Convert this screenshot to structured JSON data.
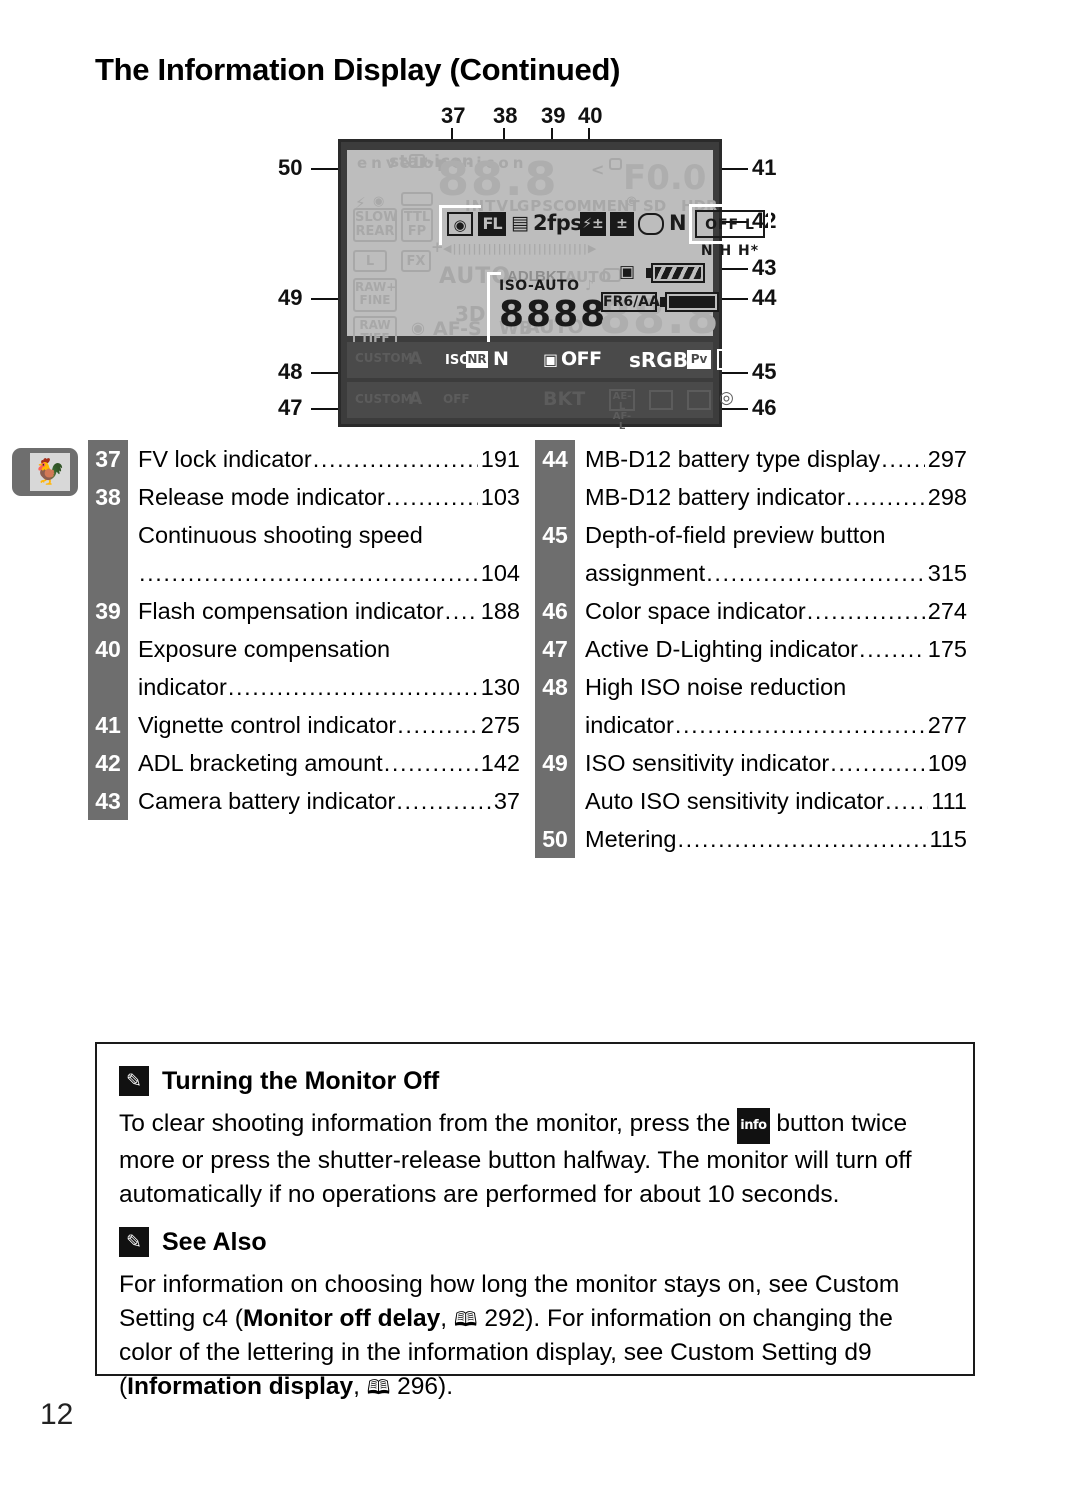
{
  "page": {
    "title": "The Information Display (Continued)",
    "number": "12",
    "chapter_tab_icon": "weathervane-rooster-icon"
  },
  "diagram": {
    "name": "camera-information-display-lcd",
    "callouts_top": [
      "37",
      "38",
      "39",
      "40"
    ],
    "callouts_left": [
      "50",
      "49",
      "48",
      "47"
    ],
    "callouts_right": [
      "41",
      "42",
      "43",
      "44",
      "45",
      "46"
    ],
    "lcd": {
      "ghost_top": [
        "envelope-icon",
        "star-icon",
        "card-icon"
      ],
      "ghost_row_left": [
        "SLOW",
        "REAR",
        "TTL",
        "FP"
      ],
      "ghost_quality": [
        "L",
        "FX",
        "RAW+",
        "FINE",
        "RAW",
        "TIFF"
      ],
      "ghost_wb": [
        "AUTO",
        "3D",
        "AF-S",
        "WB",
        "AUTO",
        "1"
      ],
      "ghost_words": [
        "INTVL",
        "GPS",
        "COMMENT",
        "ADL",
        "BKT",
        "SD",
        "HDR",
        "AUTO",
        "K"
      ],
      "active_metering": "metering-matrix-icon",
      "active_fv_lock": "FL",
      "active_release_mode": "continuous-release-icon",
      "active_fps": "2fps",
      "active_flash_comp": "flash-compensation-icon",
      "active_exp_comp": "exposure-compensation-icon",
      "active_vignette": "N",
      "active_adl_bracket": "OFF L N H H*",
      "active_iso_label": "ISO-AUTO",
      "active_iso_value": "8888",
      "active_camera_battery": "camera-battery-icon",
      "active_mbd12_label": "FR6/AA",
      "strip_row1": [
        "ISO",
        "NR",
        "N",
        "OFF",
        "sRGB",
        "Pv",
        "aperture-icon"
      ],
      "strip_row2_ghost": [
        "CUSTOM",
        "A",
        "OFF",
        "BKT",
        "AE-L",
        "AF-L"
      ],
      "shutter_ghost": "88.8",
      "aperture_ghost": "F0.0"
    }
  },
  "index": {
    "left": [
      {
        "num": "37",
        "label": "FV lock indicator",
        "page": "191",
        "dots": true
      },
      {
        "num": "38",
        "label": "Release mode indicator",
        "page": "103",
        "dots": true
      },
      {
        "num": "",
        "label": "Continuous shooting speed",
        "page": "",
        "dots": false
      },
      {
        "num": "",
        "label": "",
        "page": "104",
        "dots": true
      },
      {
        "num": "39",
        "label": "Flash compensation indicator ",
        "page": "188",
        "dots": true
      },
      {
        "num": "40",
        "label": "Exposure compensation",
        "page": "",
        "dots": false
      },
      {
        "num": "",
        "label": "indicator",
        "page": "130",
        "dots": true
      },
      {
        "num": "41",
        "label": "Vignette control indicator",
        "page": "275",
        "dots": true
      },
      {
        "num": "42",
        "label": "ADL bracketing amount ",
        "page": "142",
        "dots": true
      },
      {
        "num": "43",
        "label": "Camera battery indicator",
        "page": "37",
        "dots": true
      }
    ],
    "right": [
      {
        "num": "44",
        "label": "MB-D12 battery type display",
        "page": "297",
        "dots": true
      },
      {
        "num": "",
        "label": "MB-D12 battery indicator",
        "page": "298",
        "dots": true
      },
      {
        "num": "45",
        "label": "Depth-of-field preview button",
        "page": "",
        "dots": false
      },
      {
        "num": "",
        "label": "assignment ",
        "page": "315",
        "dots": true
      },
      {
        "num": "46",
        "label": "Color space indicator ",
        "page": "274",
        "dots": true
      },
      {
        "num": "47",
        "label": "Active D-Lighting indicator",
        "page": "175",
        "dots": true
      },
      {
        "num": "48",
        "label": "High ISO noise reduction",
        "page": "",
        "dots": false
      },
      {
        "num": "",
        "label": "indicator",
        "page": "277",
        "dots": true
      },
      {
        "num": "49",
        "label": "ISO sensitivity indicator ",
        "page": "109",
        "dots": true
      },
      {
        "num": "",
        "label": "Auto ISO sensitivity indicator ",
        "page": "111",
        "dots": true
      },
      {
        "num": "50",
        "label": "Metering ",
        "page": "115",
        "dots": true
      }
    ]
  },
  "notes": [
    {
      "icon": "pencil-note-icon",
      "title": "Turning the Monitor Off",
      "body_part1": "To clear shooting information from the monitor, press the ",
      "inline_button": "info",
      "body_part2": " button twice more or press the shutter-release button halfway. The monitor will turn off automatically if no operations are performed for about 10 seconds."
    },
    {
      "icon": "pencil-note-icon",
      "title": "See Also",
      "body_part1": "For information on choosing how long the monitor stays on, see Custom Setting c4 (",
      "bold1": "Monitor off delay",
      "mid1": ", ",
      "ref1": "292). For information on changing the color of the lettering in the information display, see Custom Setting d9 (",
      "bold2": "Information display",
      "mid2": ", ",
      "ref2": "296)."
    }
  ],
  "colors": {
    "badge_gray": "#6e6e6e",
    "lcd_body": "#3c3c3c",
    "lcd_screen": "#bdbdbd",
    "lcd_strip": "#4a4a4a",
    "ink": "#000000"
  }
}
